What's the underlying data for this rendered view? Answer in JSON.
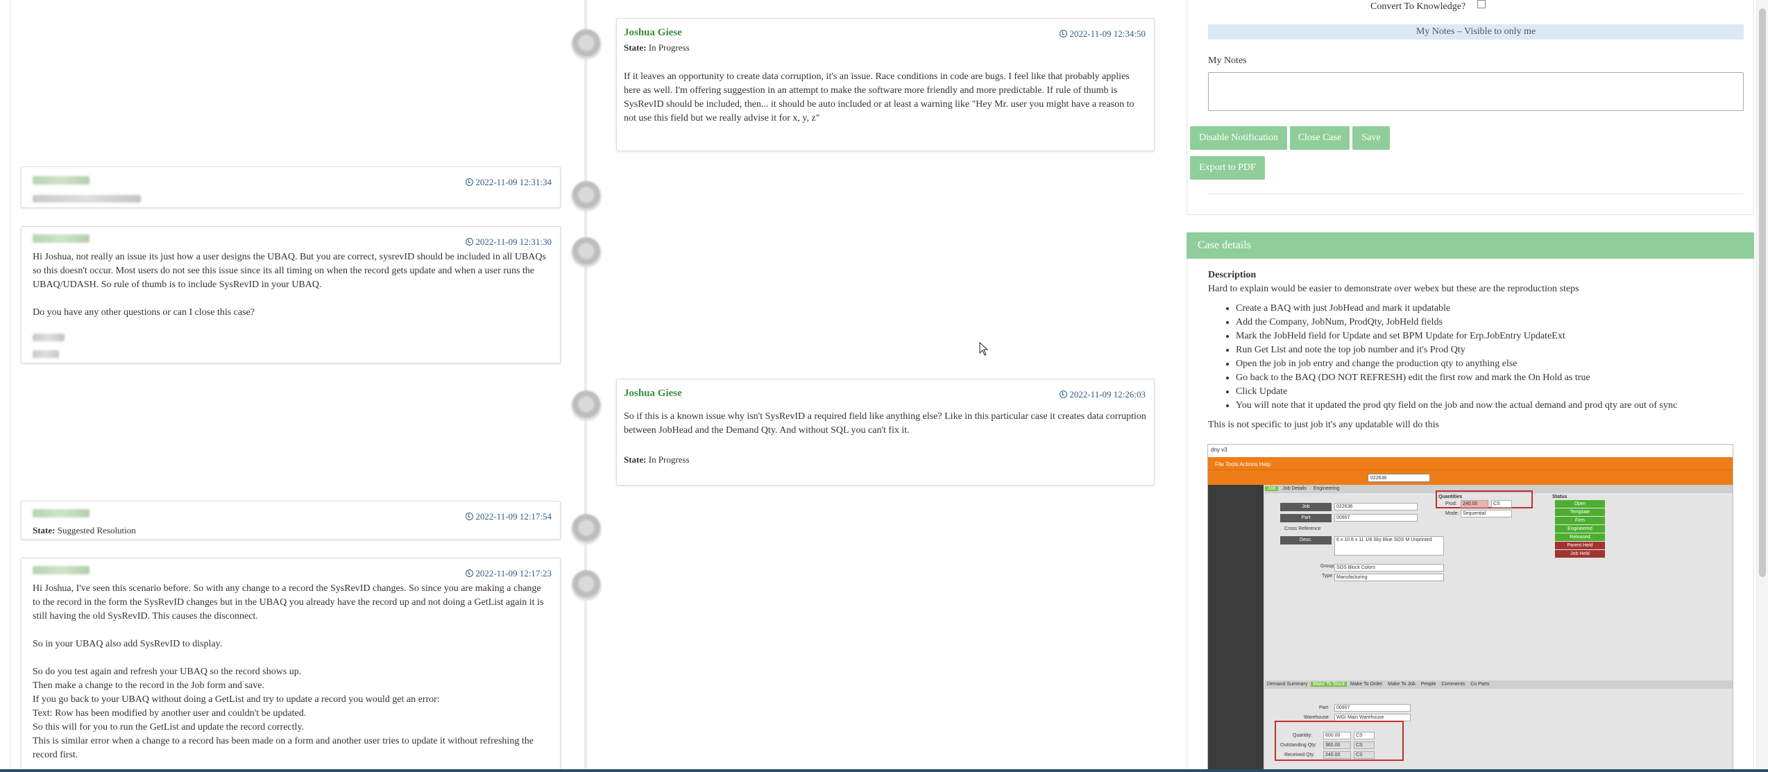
{
  "timeline": {
    "entries": [
      {
        "author": "Joshua Giese",
        "timestamp": "2022-11-09 12:34:50",
        "state_label": "State:",
        "state_value": "In Progress",
        "body": "If it leaves an opportunity to create data corruption, it's an issue. Race conditions in code are bugs. I feel like that probably applies here as well. I'm offering suggestion in an attempt to make the software more friendly and more predictable. If rule of thumb is SysRevID should be included, then... it should be auto included or at least a warning like \"Hey Mr. user you might have a reason to not use this field but we really advise it for x, y, z\""
      },
      {
        "timestamp": "2022-11-09 12:31:34"
      },
      {
        "timestamp": "2022-11-09 12:31:30",
        "body1": "Hi Joshua,  not really an issue its just how a user designs the UBAQ.  But you are correct, sysrevID should be included in all UBAQs so this doesn't occur.  Most users do not see this issue since its  all timing on when the record gets update and when a user runs the UBAQ/UDASH.   So rule of thumb is to include SysRevID in your UBAQ.",
        "body2": "Do you have any other questions or can I close this case?"
      },
      {
        "author": "Joshua Giese",
        "timestamp": "2022-11-09 12:26:03",
        "body": "So if this is a known issue why isn't SysRevID a required field like anything else? Like in this particular case it creates data corruption between JobHead and the Demand Qty. And without SQL you can't fix it.",
        "state_label": "State:",
        "state_value": "In Progress"
      },
      {
        "timestamp": "2022-11-09 12:17:54",
        "state_label": "State:",
        "state_value": "Suggested Resolution"
      },
      {
        "timestamp": "2022-11-09 12:17:23",
        "lines": [
          "Hi Joshua,  I've seen this scenario before.  So with any change to a record the SysRevID changes.  So since you are making a change to the record in the form the SysRevID changes but in the UBAQ you already have the record up and not doing a GetList again it is still having the old SysRevID. This causes the disconnect.",
          "So in your UBAQ also add SysRevID to display.",
          "So do you test again and refresh your UBAQ so the record shows up.",
          "Then make a change to the record in the Job form and save.",
          "If you go back to your UBAQ without doing a GetList and try to update a record you would get an error:",
          "Text: Row has been modified by another user and couldn't be updated.",
          "So this will for you to run the GetList and update the record correctly.",
          "This is similar error when a change to a record has been made on a form and another user tries to update it without refreshing the record first."
        ]
      }
    ]
  },
  "panel": {
    "convert_label": "Convert To Knowledge?",
    "my_notes_banner": "My Notes – Visible to only me",
    "my_notes_label": "My Notes",
    "buttons": {
      "disable_notification": "Disable Notification",
      "close_case": "Close Case",
      "save": "Save",
      "export_pdf": "Export to PDF"
    },
    "case_details_header": "Case details",
    "description_title": "Description",
    "description_intro": "Hard to explain would be easier to demonstrate over webex but these are the reproduction steps",
    "steps": [
      "Create a BAQ with just JobHead and mark it updatable",
      "Add the Company, JobNum, ProdQty, JobHeld fields",
      "Mark the JobHeld field for Update and set BPM Update for Erp.JobEntry UpdateExt",
      "Run Get List and note the top job number and it's Prod Qty",
      "Open the job in job entry and change the production qty to anything else",
      "Go back to the BAQ (DO NOT REFRESH) edit the first row and mark the On Hold as true",
      "Click Update",
      "You will note that it updated the prod qty field on the job and now the actual demand and prod qty are out of sync"
    ],
    "description_footer": "This is not specific to just job it's any updatable will do this"
  },
  "screenshot": {
    "title": "dny v3",
    "menu": "File  Tools  Actions  Help",
    "job_num": "022636",
    "tabs_top": [
      "Job",
      "Job Details",
      "Engineering"
    ],
    "labels": {
      "job": "Job",
      "part": "Part",
      "cross_ref": "Cross Reference",
      "desc": "Desc.",
      "group": "Group:",
      "type": "Type:",
      "prod": "Prod:",
      "mode": "Mode:",
      "quantities": "Quantities",
      "status": "Status"
    },
    "values": {
      "job": "022636",
      "part": "00907",
      "desc": "6 x 10.6 x 11 1/8 Sky Blue SOS M Unprinted",
      "group": "SOS Block Colors",
      "type": "Manufacturing",
      "prod": "240.00",
      "uom": "CS",
      "mode": "Sequential"
    },
    "status_buttons": [
      "Open",
      "Template",
      "Firm",
      "Engineered",
      "Released",
      "Parent Held",
      "Job Held"
    ],
    "bottom_tabs": [
      "Demand Summary",
      "Make To Stock",
      "Make To Order",
      "Make To Job",
      "People",
      "Comments",
      "Co Parts"
    ],
    "bottom_fields": {
      "part_label": "Part:",
      "part": "00907",
      "warehouse_label": "Warehouse:",
      "warehouse": "WGI Main Warehouse",
      "quantity_label": "Quantity:",
      "quantity": "600.00",
      "outstanding_label": "Outstanding Qty:",
      "outstanding": "360.00",
      "received_label": "Received Qty:",
      "received": "240.00",
      "uom": "CS"
    }
  }
}
